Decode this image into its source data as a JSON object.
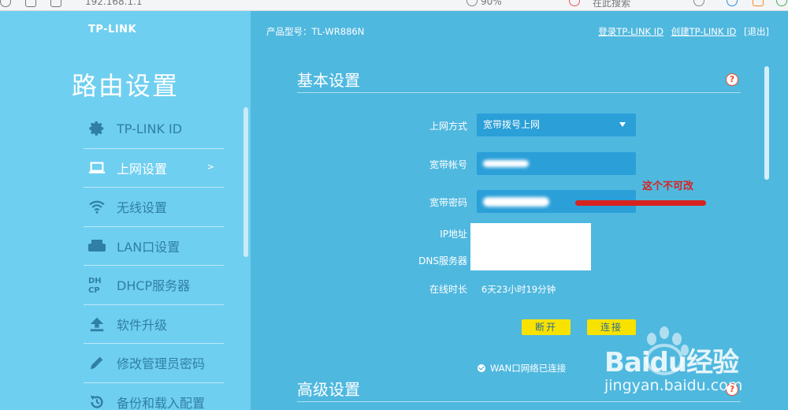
{
  "browser": {
    "url": "192.168.1.1",
    "zoom": "90%",
    "search_placeholder": "在此搜索"
  },
  "sidebar": {
    "logo": "TP-LINK",
    "title": "路由设置",
    "items": [
      {
        "label": "TP-LINK ID",
        "icon": "gear-icon"
      },
      {
        "label": "上网设置",
        "icon": "laptop-icon",
        "active": true
      },
      {
        "label": "无线设置",
        "icon": "wifi-icon"
      },
      {
        "label": "LAN口设置",
        "icon": "router-icon"
      },
      {
        "label": "DHCP服务器",
        "icon": "dhcp-icon"
      },
      {
        "label": "软件升级",
        "icon": "upload-icon"
      },
      {
        "label": "修改管理员密码",
        "icon": "pencil-icon"
      },
      {
        "label": "备份和载入配置",
        "icon": "restore-icon"
      }
    ],
    "active_chevron": ">"
  },
  "header": {
    "model": "产品型号：TL-WR886N",
    "login_link": "登录TP-LINK ID",
    "create_link": "创建TP-LINK ID",
    "logout": "[退出]"
  },
  "basic": {
    "title": "基本设置",
    "help": "?",
    "conn_type_label": "上网方式",
    "conn_type_value": "宽带拨号上网",
    "account_label": "宽带帐号",
    "password_label": "宽带密码",
    "ip_label": "IP地址",
    "dns_label": "DNS服务器",
    "uptime_label": "在线时长",
    "uptime_value": "6天23小时19分钟",
    "disconnect_button": "断开",
    "connect_button": "连接",
    "wan_status": "WAN口网络已连接"
  },
  "advanced": {
    "title": "高级设置",
    "help": "?"
  },
  "annotation": {
    "text": "这个不可改",
    "color": "#d6231f"
  },
  "watermark": {
    "brand": "Baidu经验",
    "url": "jingyan.baidu.com"
  },
  "colors": {
    "main_bg": "#4fb8df",
    "sidebar_bg": "#6fcff0",
    "field_bg": "#2a9fd8",
    "button_bg": "#f7e200"
  }
}
